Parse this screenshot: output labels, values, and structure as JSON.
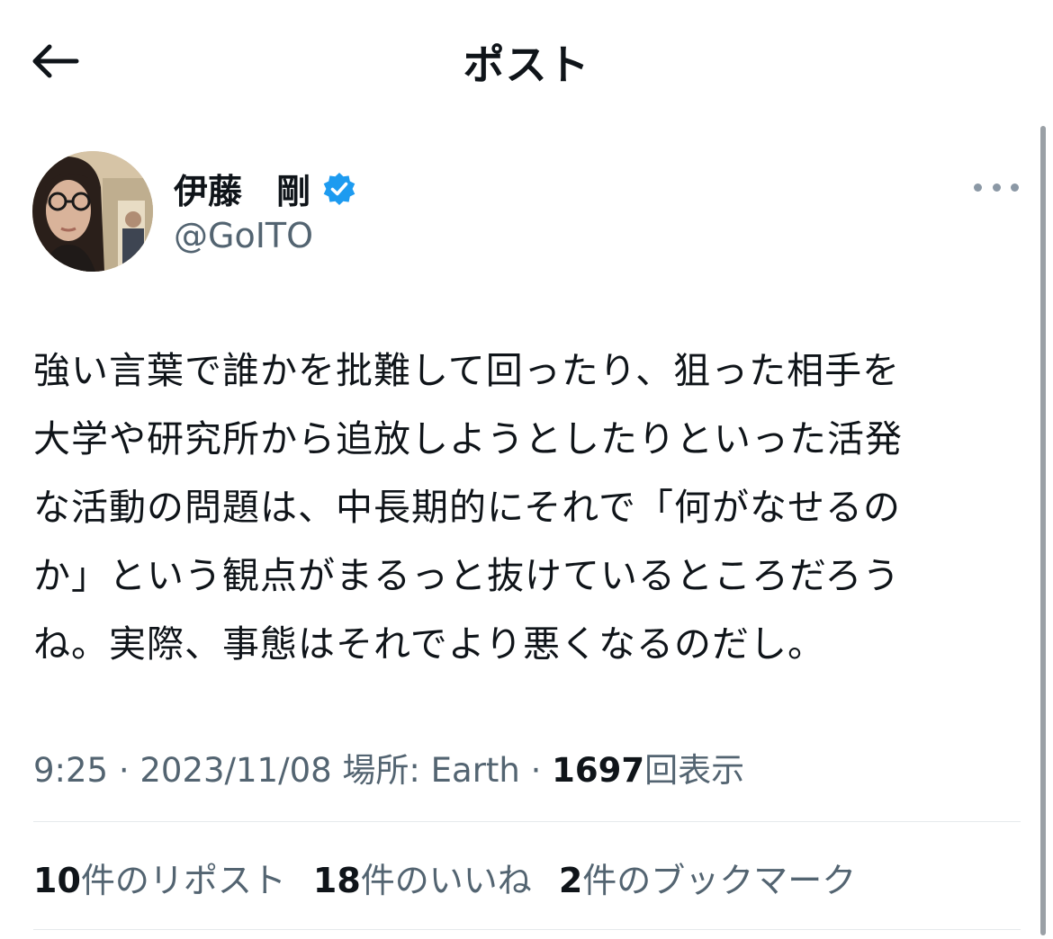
{
  "header": {
    "title": "ポスト"
  },
  "author": {
    "name": "伊藤　剛",
    "handle": "@GoITO",
    "verified": true
  },
  "tweet": {
    "lines": [
      "強い言葉で誰かを批難して回ったり、狙った相手を",
      "大学や研究所から追放しようとしたりといった活発",
      "な活動の問題は、中長期的にそれで「何がなせるの",
      "か」という観点がまるっと抜けているところだろう",
      "ね。実際、事態はそれでより悪くなるのだし。"
    ]
  },
  "meta": {
    "time": "9:25",
    "sep1": " · ",
    "date": "2023/11/08",
    "location": "場所: Earth",
    "sep2": " · ",
    "views_count": "1697",
    "views_label": "回表示"
  },
  "stats": {
    "reposts_count": "10",
    "reposts_label": "件のリポスト",
    "likes_count": "18",
    "likes_label": "件のいいね",
    "bookmarks_count": "2",
    "bookmarks_label": "件のブックマーク"
  },
  "colors": {
    "text": "#0f1419",
    "secondary": "#536471",
    "verified": "#1d9bf0",
    "divider": "#e6e9ec"
  },
  "icons": {
    "back": "arrow-left-icon",
    "verified": "verified-badge-icon",
    "more": "more-dots-icon"
  }
}
